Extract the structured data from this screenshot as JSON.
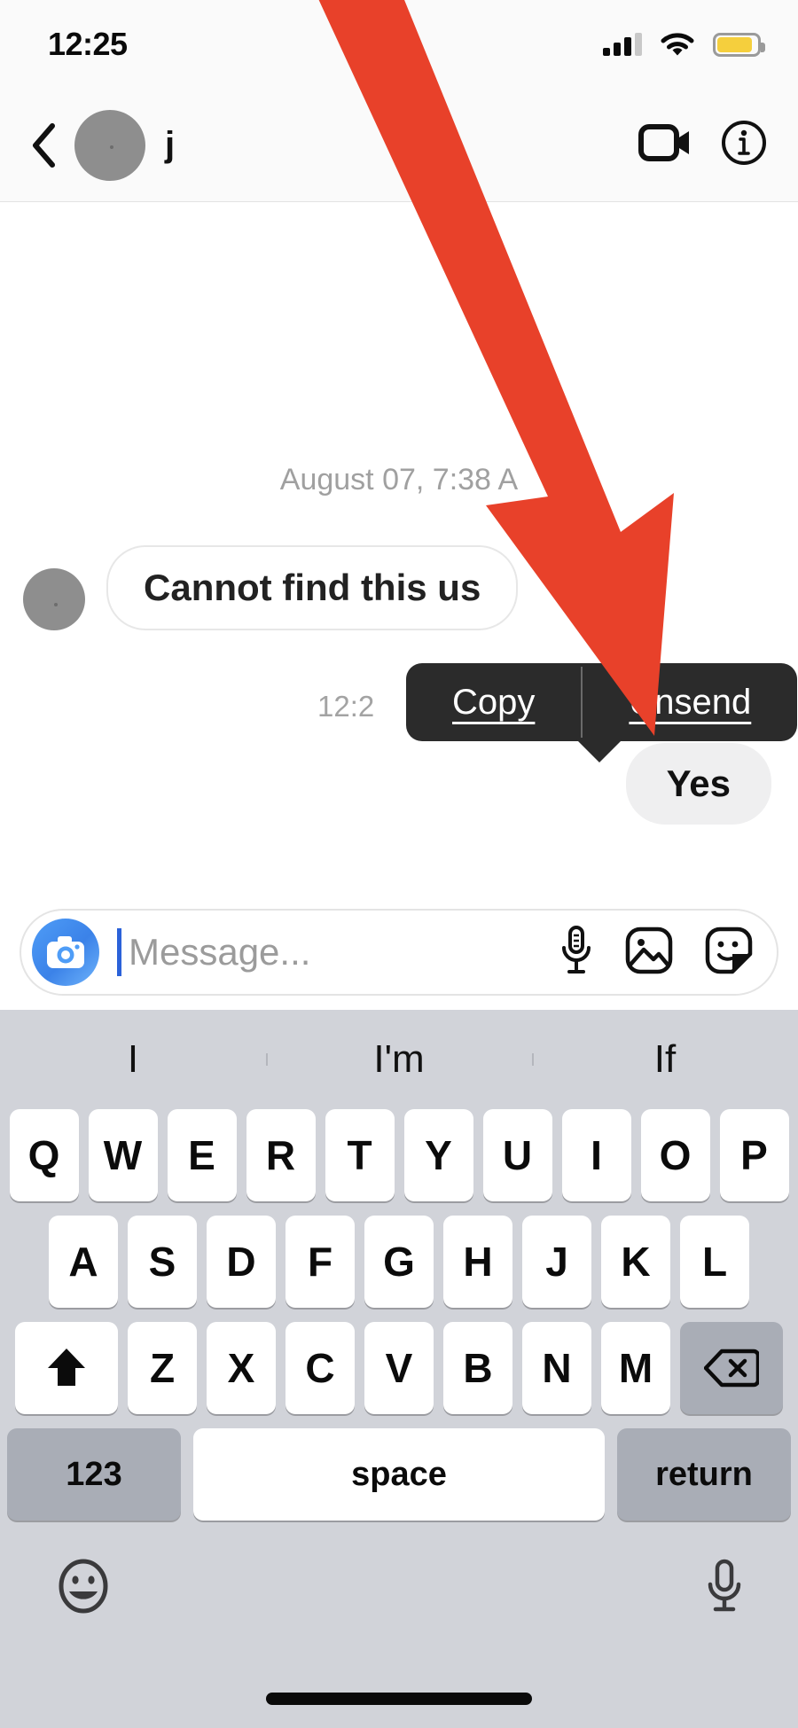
{
  "statusbar": {
    "time": "12:25",
    "signal_icon": "cellular-signal-icon",
    "wifi_icon": "wifi-icon",
    "battery_icon": "battery-icon",
    "battery_color": "#f5cf3d"
  },
  "header": {
    "back_icon": "back-chevron-icon",
    "avatar": "contact-avatar",
    "username": "j",
    "video_icon": "video-call-icon",
    "info_icon": "info-icon"
  },
  "thread": {
    "date_separator": "August 07, 7:38 A",
    "incoming": {
      "avatar": "sender-avatar",
      "text": "Cannot find this us"
    },
    "message_time": "12:2",
    "outgoing": {
      "text": "Yes"
    }
  },
  "context_menu": {
    "items": [
      {
        "label": "Copy",
        "name": "copy-menu-item"
      },
      {
        "label": "Unsend",
        "name": "unsend-menu-item"
      }
    ],
    "background": "#2b2b2b"
  },
  "input_bar": {
    "camera_icon": "camera-icon",
    "placeholder": "Message...",
    "value": "",
    "mic_icon": "microphone-icon",
    "photo_icon": "photo-library-icon",
    "sticker_icon": "sticker-icon",
    "accent": "#3b82e8"
  },
  "keyboard": {
    "suggestions": [
      "I",
      "I'm",
      "If"
    ],
    "row1": [
      "Q",
      "W",
      "E",
      "R",
      "T",
      "Y",
      "U",
      "I",
      "O",
      "P"
    ],
    "row2": [
      "A",
      "S",
      "D",
      "F",
      "G",
      "H",
      "J",
      "K",
      "L"
    ],
    "row3": [
      "Z",
      "X",
      "C",
      "V",
      "B",
      "N",
      "M"
    ],
    "shift_icon": "shift-key-icon",
    "backspace_icon": "backspace-key-icon",
    "numeric_label": "123",
    "space_label": "space",
    "return_label": "return",
    "emoji_icon": "emoji-keyboard-icon",
    "dictation_icon": "dictation-microphone-icon"
  },
  "annotation": {
    "arrow_color": "#e8412a",
    "arrow_target": "unsend-menu-item"
  }
}
